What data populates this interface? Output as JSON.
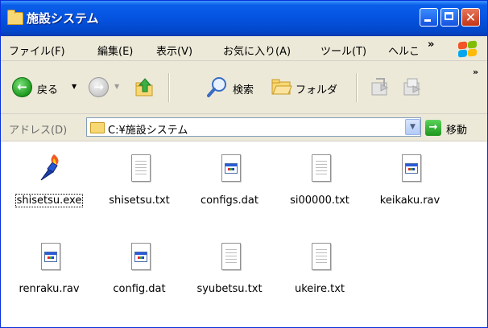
{
  "window": {
    "title": "施設システム",
    "accent": "#0553e0",
    "close_glyph": "✕"
  },
  "menu": {
    "items": [
      "ファイル(F)",
      "編集(E)",
      "表示(V)",
      "お気に入り(A)",
      "ツール(T)",
      "ヘルこ"
    ],
    "more": "»"
  },
  "toolbar": {
    "back_label": "戻る",
    "back_arrow": "←",
    "forward_arrow": "→",
    "dropdown_glyph": "▼",
    "search_label": "検索",
    "folders_label": "フォルダ",
    "more": "»"
  },
  "address": {
    "label": "アドレス(D)",
    "value": "C:¥施設システム",
    "dropdown_glyph": "▼",
    "go_arrow": "→",
    "go_label": "移動"
  },
  "files": [
    {
      "name": "shisetsu.exe",
      "icon": "exe-torch-icon",
      "selected": true
    },
    {
      "name": "shisetsu.txt",
      "icon": "text-file-icon"
    },
    {
      "name": "configs.dat",
      "icon": "dat-file-icon"
    },
    {
      "name": "si00000.txt",
      "icon": "text-file-icon"
    },
    {
      "name": "keikaku.rav",
      "icon": "dat-file-icon"
    },
    {
      "name": "renraku.rav",
      "icon": "dat-file-icon"
    },
    {
      "name": "config.dat",
      "icon": "dat-file-icon"
    },
    {
      "name": "syubetsu.txt",
      "icon": "text-file-icon"
    },
    {
      "name": "ukeire.txt",
      "icon": "text-file-icon"
    }
  ]
}
